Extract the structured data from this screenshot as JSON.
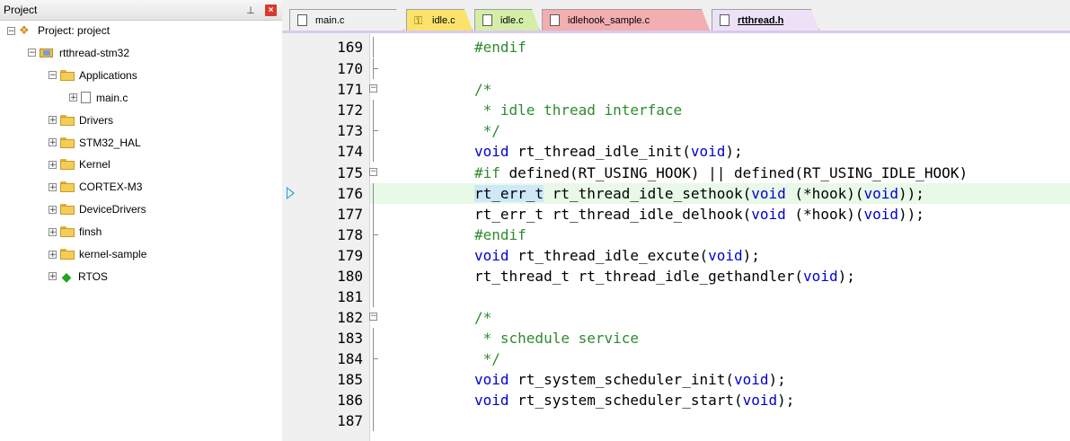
{
  "project_panel": {
    "title": "Project",
    "pin_icon": "pin-icon",
    "close_icon": "close-icon",
    "tree": [
      {
        "label": "Project: project",
        "depth": 0,
        "expander": "⊟",
        "icon": "project-icon"
      },
      {
        "label": "rtthread-stm32",
        "depth": 1,
        "expander": "⊟",
        "icon": "target-icon"
      },
      {
        "label": "Applications",
        "depth": 2,
        "expander": "⊟",
        "icon": "folder-icon"
      },
      {
        "label": "main.c",
        "depth": 3,
        "expander": "⊞",
        "icon": "file-icon"
      },
      {
        "label": "Drivers",
        "depth": 2,
        "expander": "⊞",
        "icon": "folder-icon"
      },
      {
        "label": "STM32_HAL",
        "depth": 2,
        "expander": "⊞",
        "icon": "folder-icon"
      },
      {
        "label": "Kernel",
        "depth": 2,
        "expander": "⊞",
        "icon": "folder-icon"
      },
      {
        "label": "CORTEX-M3",
        "depth": 2,
        "expander": "⊞",
        "icon": "folder-icon"
      },
      {
        "label": "DeviceDrivers",
        "depth": 2,
        "expander": "⊞",
        "icon": "folder-icon"
      },
      {
        "label": "finsh",
        "depth": 2,
        "expander": "⊞",
        "icon": "folder-icon"
      },
      {
        "label": "kernel-sample",
        "depth": 2,
        "expander": "⊞",
        "icon": "folder-icon"
      },
      {
        "label": "RTOS",
        "depth": 2,
        "expander": "⊞",
        "icon": "rtos-icon"
      }
    ]
  },
  "tabs": [
    {
      "label": "main.c",
      "color": "#f0f0f0",
      "icon": "file-icon",
      "active": false
    },
    {
      "label": "idle.c",
      "color": "#fbe36b",
      "icon": "key-file-icon",
      "active": false
    },
    {
      "label": "idle.c",
      "color": "#d4eea8",
      "icon": "file-icon",
      "active": false
    },
    {
      "label": "idlehook_sample.c",
      "color": "#f3aeb1",
      "icon": "file-icon",
      "active": false
    },
    {
      "label": "rtthread.h",
      "color": "#ece1f6",
      "icon": "file-icon",
      "active": true
    }
  ],
  "editor": {
    "current_line": 176,
    "lines": [
      {
        "num": "169",
        "fold": "line",
        "seg": [
          {
            "c": "pp",
            "t": "#endif"
          }
        ]
      },
      {
        "num": "170",
        "fold": "tick",
        "seg": []
      },
      {
        "num": "171",
        "fold": "minus",
        "seg": [
          {
            "c": "cm",
            "t": "/*"
          }
        ]
      },
      {
        "num": "172",
        "fold": "line",
        "seg": [
          {
            "c": "cm",
            "t": " * idle thread interface"
          }
        ]
      },
      {
        "num": "173",
        "fold": "tick",
        "seg": [
          {
            "c": "cm",
            "t": " */"
          }
        ]
      },
      {
        "num": "174",
        "fold": "line",
        "seg": [
          {
            "c": "kw",
            "t": "void"
          },
          {
            "c": "pl",
            "t": " rt_thread_idle_init("
          },
          {
            "c": "kw",
            "t": "void"
          },
          {
            "c": "pl",
            "t": ");"
          }
        ]
      },
      {
        "num": "175",
        "fold": "minus",
        "seg": [
          {
            "c": "pp",
            "t": "#if"
          },
          {
            "c": "pl",
            "t": " defined(RT_USING_HOOK) || defined(RT_USING_IDLE_HOOK)"
          }
        ]
      },
      {
        "num": "176",
        "fold": "line",
        "seg": [
          {
            "c": "hlt",
            "t": "rt_err_t"
          },
          {
            "c": "pl",
            "t": " rt_thread_idle_sethook("
          },
          {
            "c": "kw",
            "t": "void"
          },
          {
            "c": "pl",
            "t": " (*hook)("
          },
          {
            "c": "kw",
            "t": "void"
          },
          {
            "c": "pl",
            "t": "));"
          }
        ]
      },
      {
        "num": "177",
        "fold": "line",
        "seg": [
          {
            "c": "pl",
            "t": "rt_err_t rt_thread_idle_delhook("
          },
          {
            "c": "kw",
            "t": "void"
          },
          {
            "c": "pl",
            "t": " (*hook)("
          },
          {
            "c": "kw",
            "t": "void"
          },
          {
            "c": "pl",
            "t": "));"
          }
        ]
      },
      {
        "num": "178",
        "fold": "tick",
        "seg": [
          {
            "c": "pp",
            "t": "#endif"
          }
        ]
      },
      {
        "num": "179",
        "fold": "line",
        "seg": [
          {
            "c": "kw",
            "t": "void"
          },
          {
            "c": "pl",
            "t": " rt_thread_idle_excute("
          },
          {
            "c": "kw",
            "t": "void"
          },
          {
            "c": "pl",
            "t": ");"
          }
        ]
      },
      {
        "num": "180",
        "fold": "line",
        "seg": [
          {
            "c": "pl",
            "t": "rt_thread_t rt_thread_idle_gethandler("
          },
          {
            "c": "kw",
            "t": "void"
          },
          {
            "c": "pl",
            "t": ");"
          }
        ]
      },
      {
        "num": "181",
        "fold": "line",
        "seg": []
      },
      {
        "num": "182",
        "fold": "minus",
        "seg": [
          {
            "c": "cm",
            "t": "/*"
          }
        ]
      },
      {
        "num": "183",
        "fold": "line",
        "seg": [
          {
            "c": "cm",
            "t": " * schedule service"
          }
        ]
      },
      {
        "num": "184",
        "fold": "tick",
        "seg": [
          {
            "c": "cm",
            "t": " */"
          }
        ]
      },
      {
        "num": "185",
        "fold": "line",
        "seg": [
          {
            "c": "kw",
            "t": "void"
          },
          {
            "c": "pl",
            "t": " rt_system_scheduler_init("
          },
          {
            "c": "kw",
            "t": "void"
          },
          {
            "c": "pl",
            "t": ");"
          }
        ]
      },
      {
        "num": "186",
        "fold": "line",
        "seg": [
          {
            "c": "kw",
            "t": "void"
          },
          {
            "c": "pl",
            "t": " rt_system_scheduler_start("
          },
          {
            "c": "kw",
            "t": "void"
          },
          {
            "c": "pl",
            "t": ");"
          }
        ]
      },
      {
        "num": "187",
        "fold": "line",
        "seg": []
      }
    ]
  }
}
